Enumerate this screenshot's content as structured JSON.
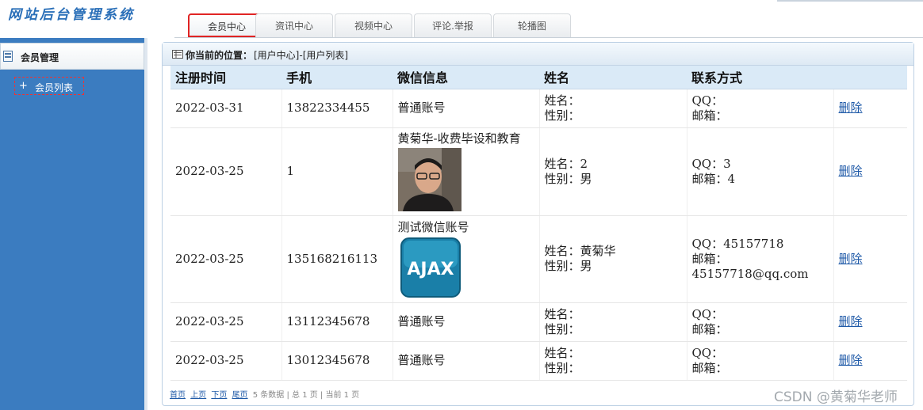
{
  "header": {
    "logo": "网站后台管理系统",
    "tabs": [
      {
        "label": "会员中心",
        "active": true
      },
      {
        "label": "资讯中心",
        "active": false
      },
      {
        "label": "视频中心",
        "active": false
      },
      {
        "label": "评论.举报",
        "active": false
      },
      {
        "label": "轮播图",
        "active": false
      }
    ]
  },
  "sidebar": {
    "section_title": "会员管理",
    "items": [
      {
        "label": "会员列表",
        "icon": "plus-icon"
      }
    ]
  },
  "breadcrumb": {
    "label": "你当前的位置：",
    "path": "[用户中心]-[用户列表]"
  },
  "table": {
    "columns": [
      "注册时间",
      "手机",
      "微信信息",
      "姓名",
      "联系方式",
      ""
    ],
    "rows": [
      {
        "date": "2022-03-31",
        "phone": "13822334455",
        "wechat": "普通账号",
        "avatar": null,
        "name": "姓名：",
        "gender": "性别：",
        "qq": "QQ：",
        "email": "邮箱：",
        "action": "删除"
      },
      {
        "date": "2022-03-25",
        "phone": "1",
        "wechat": "黄菊华-收费毕设和教育",
        "avatar": "person-photo",
        "name": "姓名：2",
        "gender": "性别：男",
        "qq": "QQ：3",
        "email": "邮箱：4",
        "action": "删除"
      },
      {
        "date": "2022-03-25",
        "phone": "135168216113",
        "wechat": "测试微信账号",
        "avatar": "ajax-logo",
        "name": "姓名：黄菊华",
        "gender": "性别：男",
        "qq": "QQ：45157718",
        "email": "邮箱：45157718@qq.com",
        "action": "删除"
      },
      {
        "date": "2022-03-25",
        "phone": "13112345678",
        "wechat": "普通账号",
        "avatar": null,
        "name": "姓名：",
        "gender": "性别：",
        "qq": "QQ：",
        "email": "邮箱：",
        "action": "删除"
      },
      {
        "date": "2022-03-25",
        "phone": "13012345678",
        "wechat": "普通账号",
        "avatar": null,
        "name": "姓名：",
        "gender": "性别：",
        "qq": "QQ：",
        "email": "邮箱：",
        "action": "删除"
      }
    ],
    "ajax_logo_text": "AJAX"
  },
  "pager": {
    "first": "首页",
    "prev": "上页",
    "next": "下页",
    "last": "尾页",
    "summary": "5 条数据 | 总 1 页 | 当前 1 页"
  },
  "watermark": "CSDN @黄菊华老师",
  "colors": {
    "sidebar_bg": "#3b7cc0",
    "active_tab_border": "#e02424",
    "link": "#1f5aa8",
    "table_header_bg": "#daeaf7"
  }
}
